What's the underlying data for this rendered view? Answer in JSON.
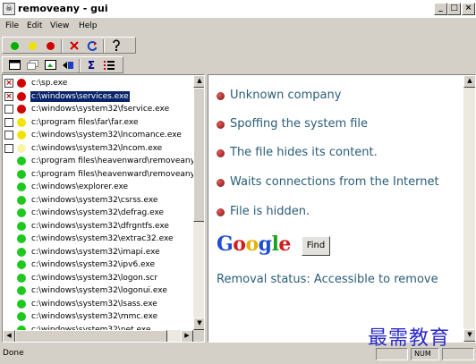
{
  "window": {
    "title": "removeany - gui",
    "minimize_glyph": "_",
    "maximize_glyph": "□",
    "close_glyph": "×"
  },
  "menu": [
    "File",
    "Edit",
    "View",
    "Help"
  ],
  "toolbar1": {
    "buttons": [
      {
        "name": "green-dot-button",
        "icon": "green-circle-icon",
        "color": "#00b000"
      },
      {
        "name": "yellow-dot-button",
        "icon": "yellow-circle-icon",
        "color": "#f0e000"
      },
      {
        "name": "red-dot-button",
        "icon": "red-circle-icon",
        "color": "#d00000"
      },
      {
        "name": "delete-button",
        "icon": "red-x-icon"
      },
      {
        "name": "refresh-button",
        "icon": "refresh-icon"
      },
      {
        "name": "help-button",
        "icon": "question-mark-icon"
      }
    ]
  },
  "toolbar2": {
    "buttons": [
      {
        "name": "window-button",
        "icon": "window-icon"
      },
      {
        "name": "restore-button",
        "icon": "restore-icon"
      },
      {
        "name": "image-button",
        "icon": "image-icon"
      },
      {
        "name": "move-button",
        "icon": "move-icon"
      },
      {
        "name": "sum-button",
        "icon": "sigma-icon",
        "glyph": "Σ"
      },
      {
        "name": "list-button",
        "icon": "list-icon"
      }
    ]
  },
  "processes": [
    {
      "path": "c:\\sp.exe",
      "checked": true,
      "status": "red",
      "selected": false
    },
    {
      "path": "c:\\windows\\services.exe",
      "checked": true,
      "status": "red",
      "selected": true
    },
    {
      "path": "c:\\windows\\system32\\fservice.exe",
      "checked": false,
      "status": "red",
      "selected": false
    },
    {
      "path": "c:\\program files\\far\\far.exe",
      "checked": false,
      "status": "yellow",
      "selected": false
    },
    {
      "path": "c:\\windows\\system32\\lncomance.exe",
      "checked": false,
      "status": "yellow",
      "selected": false
    },
    {
      "path": "c:\\windows\\system32\\lncom.exe",
      "checked": false,
      "status": "yellow-faint",
      "selected": false
    },
    {
      "path": "c:\\program files\\heavenward\\removeany",
      "checked": null,
      "status": "green",
      "selected": false
    },
    {
      "path": "c:\\program files\\heavenward\\removeany",
      "checked": null,
      "status": "green",
      "selected": false
    },
    {
      "path": "c:\\windows\\explorer.exe",
      "checked": null,
      "status": "green",
      "selected": false
    },
    {
      "path": "c:\\windows\\system32\\csrss.exe",
      "checked": null,
      "status": "green",
      "selected": false
    },
    {
      "path": "c:\\windows\\system32\\defrag.exe",
      "checked": null,
      "status": "green",
      "selected": false
    },
    {
      "path": "c:\\windows\\system32\\dfrgntfs.exe",
      "checked": null,
      "status": "green",
      "selected": false
    },
    {
      "path": "c:\\windows\\system32\\extrac32.exe",
      "checked": null,
      "status": "green",
      "selected": false
    },
    {
      "path": "c:\\windows\\system32\\imapi.exe",
      "checked": null,
      "status": "green",
      "selected": false
    },
    {
      "path": "c:\\windows\\system32\\ipv6.exe",
      "checked": null,
      "status": "green",
      "selected": false
    },
    {
      "path": "c:\\windows\\system32\\logon.scr",
      "checked": null,
      "status": "green",
      "selected": false
    },
    {
      "path": "c:\\windows\\system32\\logonui.exe",
      "checked": null,
      "status": "green",
      "selected": false
    },
    {
      "path": "c:\\windows\\system32\\lsass.exe",
      "checked": null,
      "status": "green",
      "selected": false
    },
    {
      "path": "c:\\windows\\system32\\mmc.exe",
      "checked": null,
      "status": "green",
      "selected": false
    },
    {
      "path": "c:\\windows\\system32\\net.exe",
      "checked": null,
      "status": "green",
      "selected": false
    }
  ],
  "status_colors": {
    "red": "#d00000",
    "yellow": "#f2e400",
    "yellow-faint": "#f7f3a8",
    "green": "#1ec81e"
  },
  "details": {
    "items": [
      "Unknown company",
      "Spoffing the system file",
      "The file hides its content.",
      "Waits connections from the Internet",
      "File is hidden."
    ],
    "google_letters": [
      {
        "ch": "G",
        "color": "#1f4fcf"
      },
      {
        "ch": "o",
        "color": "#d21b1b"
      },
      {
        "ch": "o",
        "color": "#e8b000"
      },
      {
        "ch": "g",
        "color": "#1f4fcf"
      },
      {
        "ch": "l",
        "color": "#1aa31a"
      },
      {
        "ch": "e",
        "color": "#d21b1b"
      }
    ],
    "find_label": "Find",
    "removal_status": "Removal status: Accessible to remove"
  },
  "scroll_glyphs": {
    "up": "▲",
    "down": "▼",
    "left": "◀",
    "right": "▶"
  },
  "watermark": "最需教育",
  "status": {
    "text": "Done",
    "num": "NUM"
  }
}
